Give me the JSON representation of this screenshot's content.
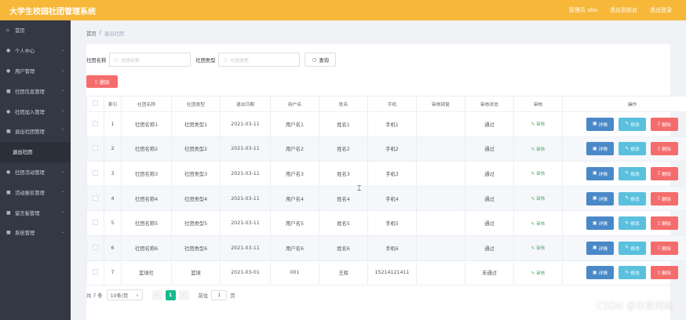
{
  "header": {
    "app_title": "大学生校园社团管理系统",
    "links": [
      "管理员 abo",
      "退出到前台",
      "退出登录"
    ]
  },
  "sidebar": {
    "items": [
      {
        "label": "首页",
        "icon": "home-icon",
        "chevron": false
      },
      {
        "label": "个人中心",
        "icon": "user-icon",
        "chevron": true
      },
      {
        "label": "用户管理",
        "icon": "users-icon",
        "chevron": true
      },
      {
        "label": "社团信息管理",
        "icon": "folder-icon",
        "chevron": true
      },
      {
        "label": "社团加入管理",
        "icon": "user-add-icon",
        "chevron": true
      },
      {
        "label": "退出社团管理",
        "icon": "logout-icon",
        "chevron": true
      },
      {
        "label": "退出社团",
        "sub": true
      },
      {
        "label": "社团活动管理",
        "icon": "calendar-icon",
        "chevron": true
      },
      {
        "label": "活动报名管理",
        "icon": "signup-icon",
        "chevron": true
      },
      {
        "label": "留言板管理",
        "icon": "message-icon",
        "chevron": true
      },
      {
        "label": "系统管理",
        "icon": "settings-icon",
        "chevron": true
      }
    ]
  },
  "breadcrumb": {
    "home": "首页",
    "separator": "/",
    "current": "退出社团"
  },
  "search": {
    "name_label": "社团名称",
    "name_placeholder": "社团名称",
    "type_label": "社团类型",
    "type_placeholder": "社团类型",
    "button": "查询"
  },
  "toolbar": {
    "delete_label": "删除"
  },
  "table": {
    "headers": [
      "",
      "索引",
      "社团名称",
      "社团类型",
      "退出日期",
      "用户名",
      "姓名",
      "手机",
      "审核回复",
      "审核状态",
      "审核",
      "操作"
    ],
    "audit_label": "审核",
    "op_detail": "详情",
    "op_edit": "修改",
    "op_delete": "删除",
    "rows": [
      {
        "index": "1",
        "name": "社团名称1",
        "type": "社团类型1",
        "date": "2021-03-11",
        "username": "用户名1",
        "realname": "姓名1",
        "phone": "手机1",
        "reply": "",
        "status": "通过"
      },
      {
        "index": "2",
        "name": "社团名称2",
        "type": "社团类型2",
        "date": "2021-03-11",
        "username": "用户名2",
        "realname": "姓名2",
        "phone": "手机2",
        "reply": "",
        "status": "通过"
      },
      {
        "index": "3",
        "name": "社团名称3",
        "type": "社团类型3",
        "date": "2021-03-11",
        "username": "用户名3",
        "realname": "姓名3",
        "phone": "手机3",
        "reply": "",
        "status": "通过"
      },
      {
        "index": "4",
        "name": "社团名称4",
        "type": "社团类型4",
        "date": "2021-03-11",
        "username": "用户名4",
        "realname": "姓名4",
        "phone": "手机4",
        "reply": "",
        "status": "通过"
      },
      {
        "index": "5",
        "name": "社团名称5",
        "type": "社团类型5",
        "date": "2021-03-11",
        "username": "用户名5",
        "realname": "姓名5",
        "phone": "手机5",
        "reply": "",
        "status": "通过"
      },
      {
        "index": "6",
        "name": "社团名称6",
        "type": "社团类型6",
        "date": "2021-03-11",
        "username": "用户名6",
        "realname": "姓名6",
        "phone": "手机6",
        "reply": "",
        "status": "通过"
      },
      {
        "index": "7",
        "name": "篮球社",
        "type": "篮球",
        "date": "2021-03-01",
        "username": "001",
        "realname": "王辉",
        "phone": "15214121411",
        "reply": "",
        "status": "未通过"
      }
    ]
  },
  "pagination": {
    "total": "共 7 条",
    "page_size": "10条/页",
    "current_page": "1",
    "goto_label": "前往",
    "goto_value": "1",
    "page_suffix": "页"
  },
  "watermark": "CSDN @米恩网络",
  "colors": {
    "topbar": "#f7b739",
    "sidebar": "#333844",
    "detail": "#4a89c8",
    "edit": "#5bc0de",
    "delete": "#f56c6c",
    "active_page": "#17ba8d"
  }
}
